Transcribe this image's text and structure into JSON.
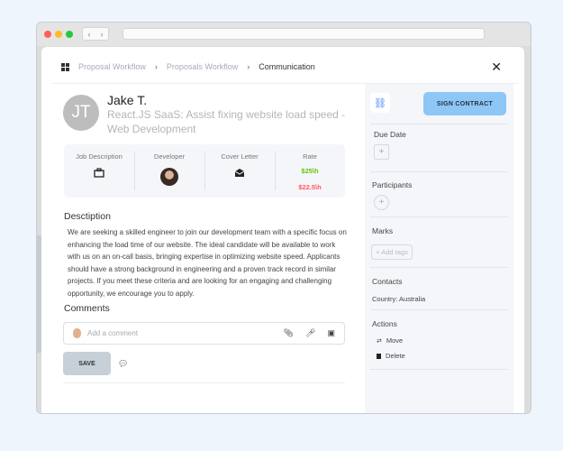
{
  "breadcrumb": [
    "Proposal Workflow",
    "Proposals Workflow",
    "Communication"
  ],
  "profile": {
    "initials": "JT",
    "name": "Jake T.",
    "job_title": "React.JS SaaS: Assist fixing website load speed - Web Development"
  },
  "info": {
    "job_description": "Job Description",
    "developer": "Developer",
    "cover_letter": "Cover Letter",
    "rate": "Rate",
    "rate_primary": "$25\\h",
    "rate_secondary": "$22.5\\h"
  },
  "description": {
    "heading": "Desctiption",
    "text": "We are seeking a skilled engineer to join our development team with a specific focus on enhancing the load time of our website. The ideal candidate will be available to work with us on an on-call basis, bringing expertise in optimizing website speed. Applicants should have a strong background in engineering and a proven track record in similar projects. If you meet these criteria and are looking for an engaging and challenging opportunity, we encourage you to apply."
  },
  "comments": {
    "heading": "Comments",
    "placeholder": "Add a comment",
    "save": "SAVE"
  },
  "sidebar": {
    "sign_contract": "SIGN CONTRACT",
    "due_date": "Due Date",
    "participants": "Participants",
    "marks": "Marks",
    "add_tags": "+ Add tags",
    "contacts": "Contacts",
    "country": "Country: Australia",
    "actions": "Actions",
    "move": "Move",
    "delete": "Delete"
  },
  "colors": {
    "accent": "#8ec6f5",
    "rate_green": "#6ac10a",
    "rate_red": "#ff5a5a"
  }
}
